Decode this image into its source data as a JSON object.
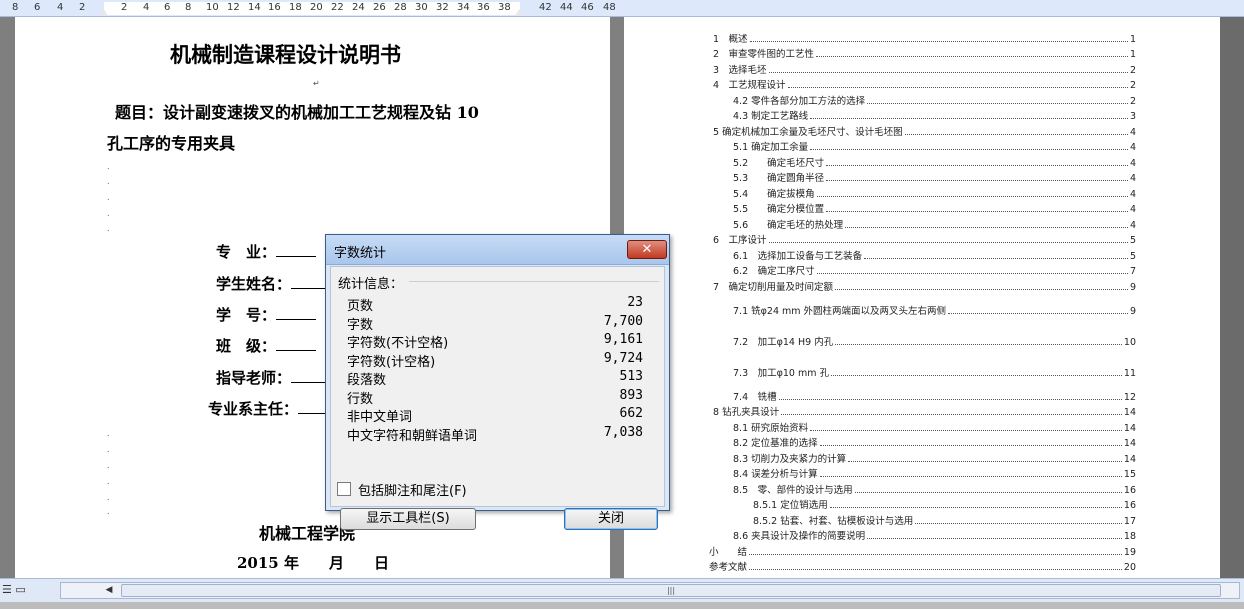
{
  "ruler": {
    "ticks": [
      "8",
      "6",
      "4",
      "2",
      "2",
      "4",
      "6",
      "8",
      "10",
      "12",
      "14",
      "16",
      "18",
      "20",
      "22",
      "24",
      "26",
      "28",
      "30",
      "32",
      "34",
      "36",
      "38",
      "42",
      "44",
      "46",
      "48"
    ]
  },
  "left_page": {
    "title": "机械制造课程设计说明书",
    "subject_line1": "题目：设计副变速拨叉的机械加工工艺规程及钻 10",
    "subject_line2": "孔工序的专用夹具",
    "fields": [
      {
        "label": "专　业："
      },
      {
        "label": "学生姓名："
      },
      {
        "label": "学　号："
      },
      {
        "label": "班　级："
      },
      {
        "label": "指导老师："
      },
      {
        "label": "专业系主任："
      }
    ],
    "school": "机械工程学院",
    "date": "2015 年　　月　　日"
  },
  "toc": [
    {
      "text": "1　概述",
      "page": "1"
    },
    {
      "text": "2　审查零件图的工艺性",
      "page": "1"
    },
    {
      "text": "3　选择毛坯",
      "page": "2"
    },
    {
      "text": "4　工艺规程设计",
      "page": "2"
    },
    {
      "text": "4.2 零件各部分加工方法的选择",
      "page": "2"
    },
    {
      "text": "4.3 制定工艺路线",
      "page": "3"
    },
    {
      "text": "5 确定机械加工余量及毛坯尺寸、设计毛坯图",
      "page": "4"
    },
    {
      "text": "5.1 确定加工余量",
      "page": "4"
    },
    {
      "text": "5.2　　确定毛坯尺寸",
      "page": "4"
    },
    {
      "text": "5.3　　确定圆角半径",
      "page": "4"
    },
    {
      "text": "5.4　　确定拔模角",
      "page": "4"
    },
    {
      "text": "5.5　　确定分模位置",
      "page": "4"
    },
    {
      "text": "5.6　　确定毛坯的热处理",
      "page": "4"
    },
    {
      "text": "6　工序设计",
      "page": "5"
    },
    {
      "text": "6.1　选择加工设备与工艺装备",
      "page": "5"
    },
    {
      "text": "6.2　确定工序尺寸",
      "page": "7"
    },
    {
      "text": "7　确定切削用量及时间定额",
      "page": "9"
    },
    {
      "text": "7.1 铣φ24 mm 外圆柱两端面以及两叉头左右两侧",
      "page": "9"
    },
    {
      "text": "7.2　加工φ14 H9 内孔",
      "page": "10"
    },
    {
      "text": "7.3　加工φ10 mm 孔",
      "page": "11"
    },
    {
      "text": "7.4　铣槽",
      "page": "12"
    },
    {
      "text": "8 钻孔夹具设计",
      "page": "14"
    },
    {
      "text": "8.1 研究原始资料",
      "page": "14"
    },
    {
      "text": "8.2 定位基准的选择",
      "page": "14"
    },
    {
      "text": "8.3 切削力及夹紧力的计算",
      "page": "14"
    },
    {
      "text": "8.4 误差分析与计算",
      "page": "15"
    },
    {
      "text": "8.5　零、部件的设计与选用",
      "page": "16"
    },
    {
      "text": "8.5.1 定位销选用",
      "page": "16"
    },
    {
      "text": "8.5.2 钻套、衬套、钻模板设计与选用",
      "page": "17"
    },
    {
      "text": "8.6 夹具设计及操作的简要说明",
      "page": "18"
    },
    {
      "text": "小　　结",
      "page": "19"
    },
    {
      "text": "参考文献",
      "page": "20"
    }
  ],
  "dialog": {
    "title": "字数统计",
    "close_glyph": "✕",
    "section_label": "统计信息：",
    "stats": [
      {
        "label": "页数",
        "value": "23"
      },
      {
        "label": "字数",
        "value": "7,700"
      },
      {
        "label": "字符数(不计空格)",
        "value": "9,161"
      },
      {
        "label": "字符数(计空格)",
        "value": "9,724"
      },
      {
        "label": "段落数",
        "value": "513"
      },
      {
        "label": "行数",
        "value": "893"
      },
      {
        "label": "非中文单词",
        "value": "662"
      },
      {
        "label": "中文字符和朝鲜语单词",
        "value": "7,038"
      }
    ],
    "checkbox_label": "包括脚注和尾注(F)",
    "toolbar_button": "显示工具栏(S)",
    "close_button": "关闭"
  },
  "scrollbar": {
    "thumb_grip": "|||"
  },
  "colors": {
    "dialog_title_bg": "#b4cdef",
    "close_red": "#c94a33",
    "page_bg": "#ffffff",
    "workspace_bg": "#7f7f7f"
  }
}
